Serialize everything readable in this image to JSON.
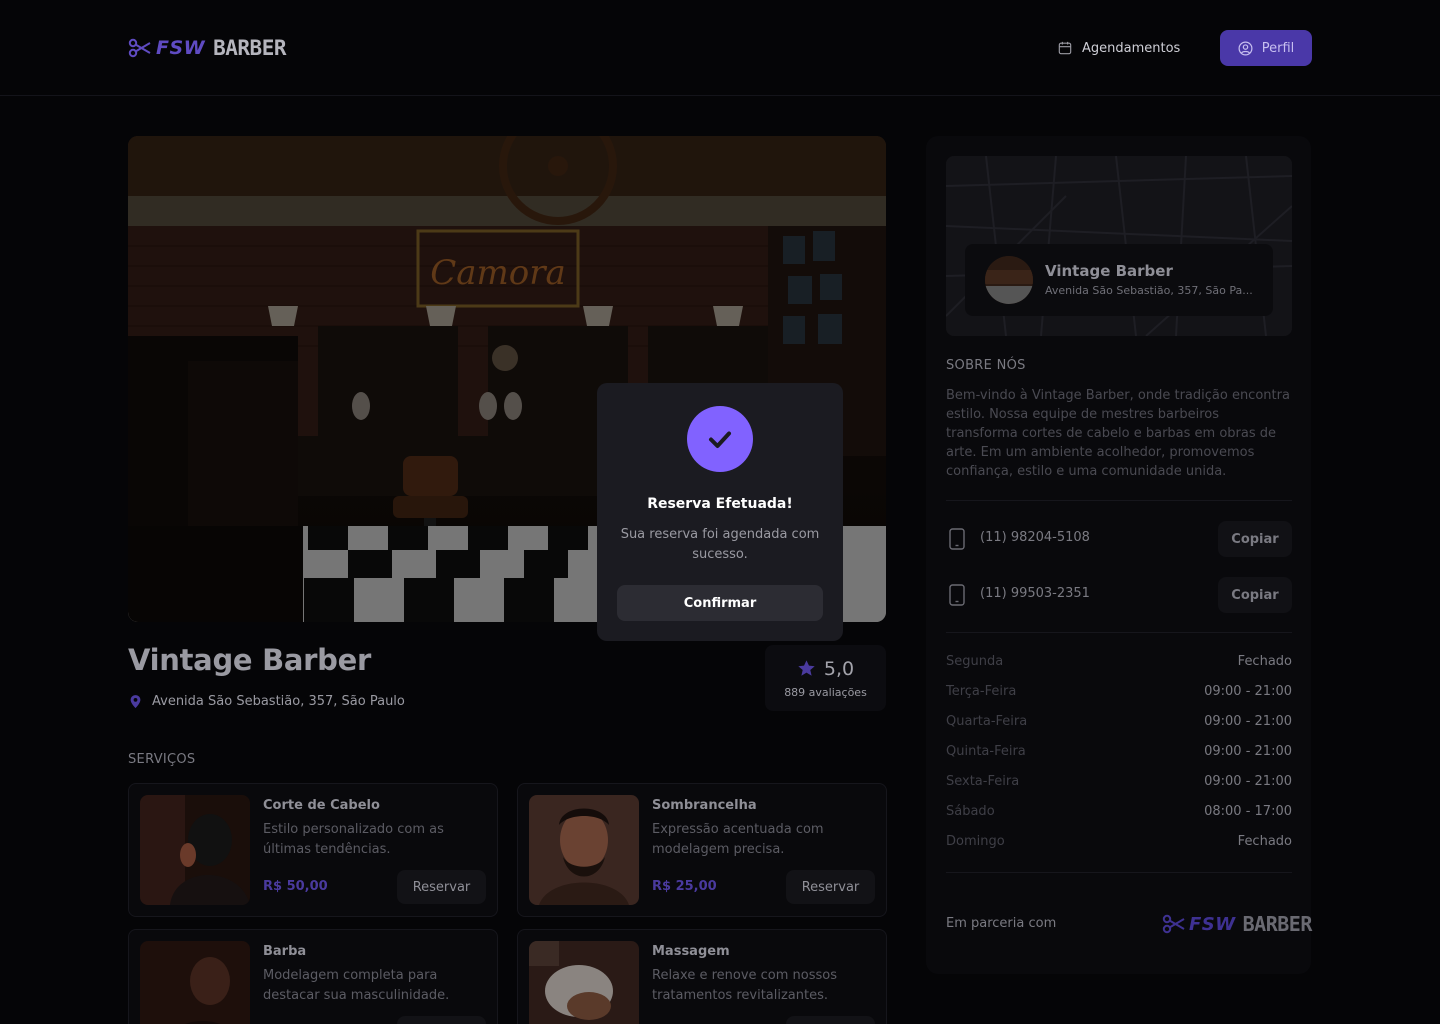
{
  "brand": {
    "logo_prefix": "FSW",
    "logo_suffix": "BARBER",
    "accent": "#8162ff"
  },
  "header": {
    "bookings_label": "Agendamentos",
    "profile_label": "Perfil"
  },
  "shop": {
    "name": "Vintage Barber",
    "address": "Avenida São Sebastião, 357, São Paulo",
    "address_short": "Avenida São Sebastião, 357, São Pa...",
    "rating": "5,0",
    "reviews": "889 avaliações"
  },
  "services": {
    "title": "SERVIÇOS",
    "items": [
      {
        "name": "Corte de Cabelo",
        "description": "Estilo personalizado com as últimas tendências.",
        "price": "R$ 50,00",
        "button": "Reservar"
      },
      {
        "name": "Sombrancelha",
        "description": "Expressão acentuada com modelagem precisa.",
        "price": "R$ 25,00",
        "button": "Reservar"
      },
      {
        "name": "Barba",
        "description": "Modelagem completa para destacar sua masculinidade.",
        "price": "",
        "button": ""
      },
      {
        "name": "Massagem",
        "description": "Relaxe e renove com nossos tratamentos revitalizantes.",
        "price": "",
        "button": ""
      }
    ]
  },
  "sidebar": {
    "about_title": "SOBRE NÓS",
    "about_text": "Bem-vindo à Vintage Barber, onde tradição encontra estilo. Nossa equipe de mestres barbeiros transforma cortes de cabelo e barbas em obras de arte. Em um ambiente acolhedor, promovemos confiança, estilo e uma comunidade unida.",
    "phones": [
      {
        "number": "(11) 98204-5108",
        "button": "Copiar"
      },
      {
        "number": "(11) 99503-2351",
        "button": "Copiar"
      }
    ],
    "hours": [
      {
        "day": "Segunda",
        "time": "Fechado"
      },
      {
        "day": "Terça-Feira",
        "time": "09:00 - 21:00"
      },
      {
        "day": "Quarta-Feira",
        "time": "09:00 - 21:00"
      },
      {
        "day": "Quinta-Feira",
        "time": "09:00 - 21:00"
      },
      {
        "day": "Sexta-Feira",
        "time": "09:00 - 21:00"
      },
      {
        "day": "Sábado",
        "time": "08:00 - 17:00"
      },
      {
        "day": "Domingo",
        "time": "Fechado"
      }
    ],
    "partner_text": "Em parceria com"
  },
  "dialog": {
    "title": "Reserva Efetuada!",
    "description": "Sua reserva foi agendada com sucesso.",
    "button": "Confirmar"
  }
}
